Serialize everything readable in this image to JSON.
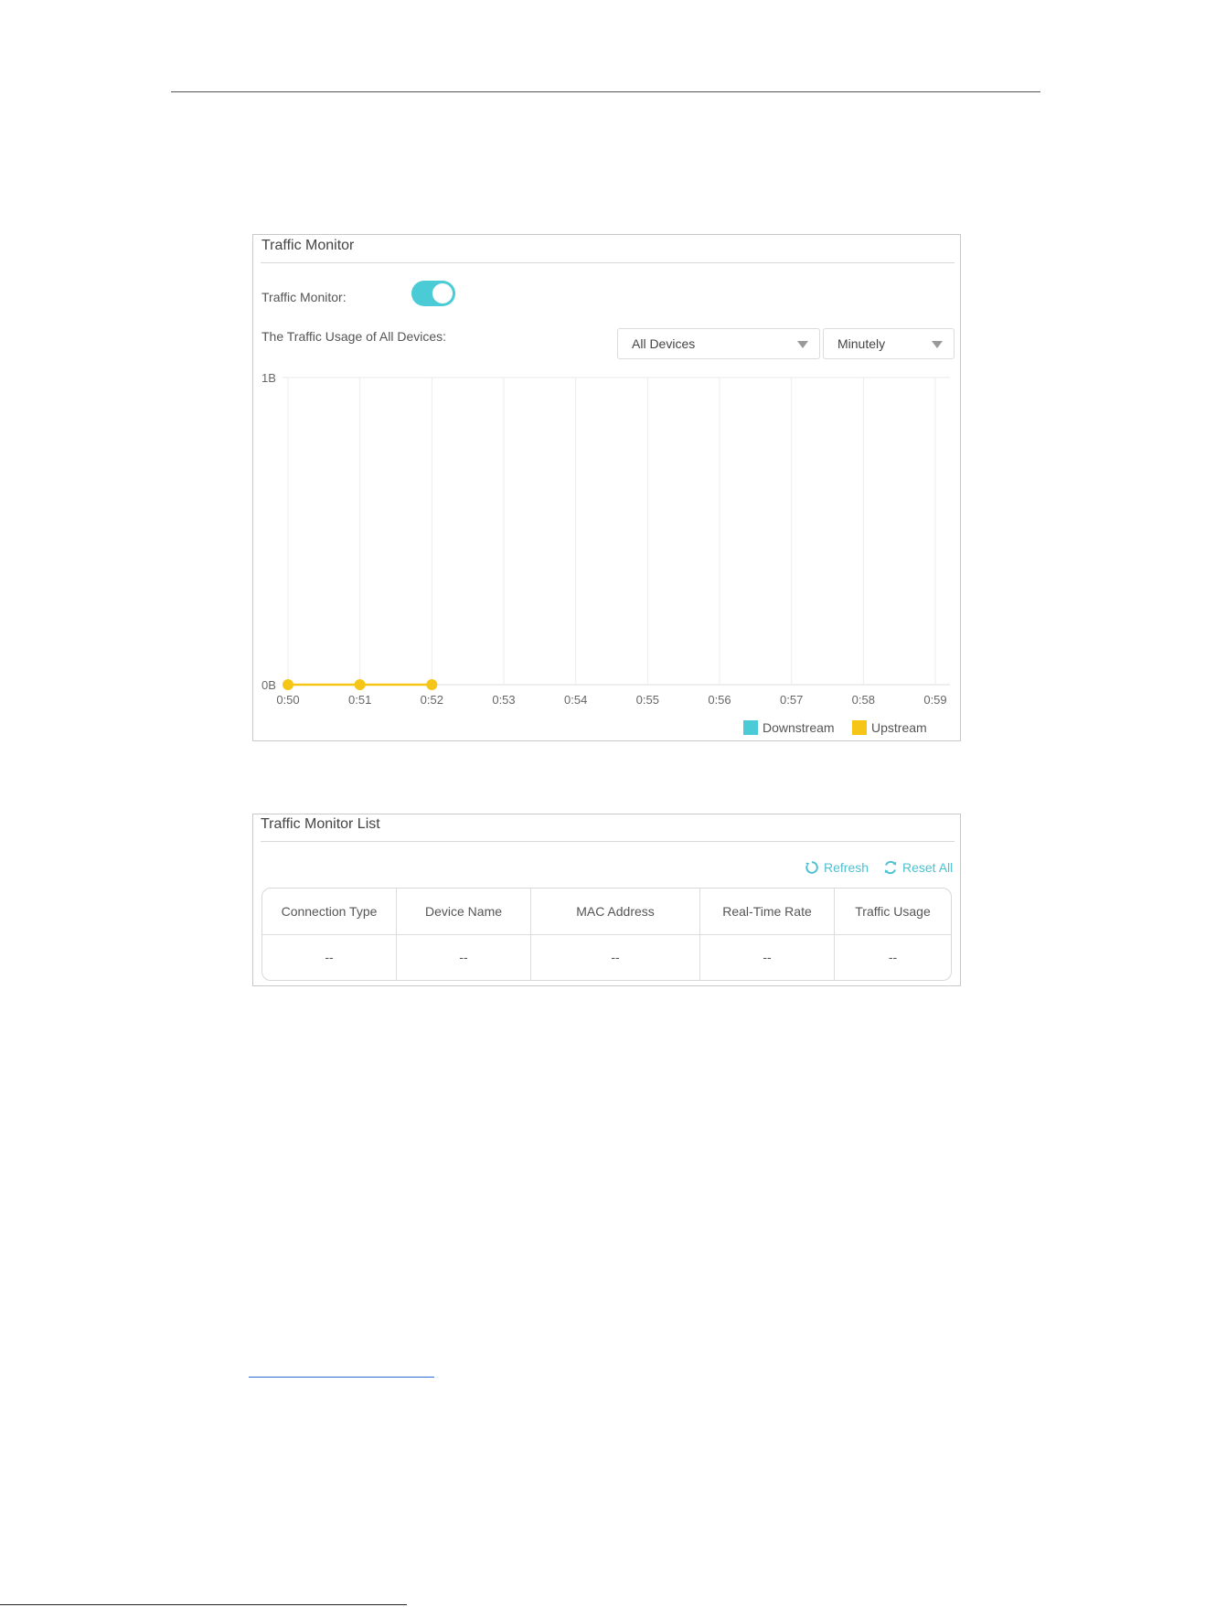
{
  "monitor": {
    "title": "Traffic Monitor",
    "toggle_label": "Traffic Monitor:",
    "toggle_state": "on",
    "usage_label": "The Traffic Usage of All Devices:",
    "device_select": "All Devices",
    "interval_select": "Minutely"
  },
  "chart_data": {
    "type": "line",
    "x": [
      "0:50",
      "0:51",
      "0:52",
      "0:53",
      "0:54",
      "0:55",
      "0:56",
      "0:57",
      "0:58",
      "0:59"
    ],
    "y_ticks": [
      "1B",
      "0B"
    ],
    "ylim": [
      0,
      1
    ],
    "grid": "vertical",
    "legend_position": "bottom-right",
    "series": [
      {
        "name": "Downstream",
        "color": "#4acbd6",
        "values": []
      },
      {
        "name": "Upstream",
        "color": "#f5c518",
        "values": [
          0,
          0,
          0
        ]
      }
    ]
  },
  "list": {
    "title": "Traffic Monitor List",
    "refresh_label": "Refresh",
    "reset_label": "Reset All",
    "columns": [
      "Connection Type",
      "Device Name",
      "MAC Address",
      "Real-Time Rate",
      "Traffic Usage"
    ],
    "row": [
      "--",
      "--",
      "--",
      "--",
      "--"
    ]
  },
  "colors": {
    "accent": "#4acbd6",
    "upstream": "#f5c518",
    "link": "#4fc0d0"
  }
}
